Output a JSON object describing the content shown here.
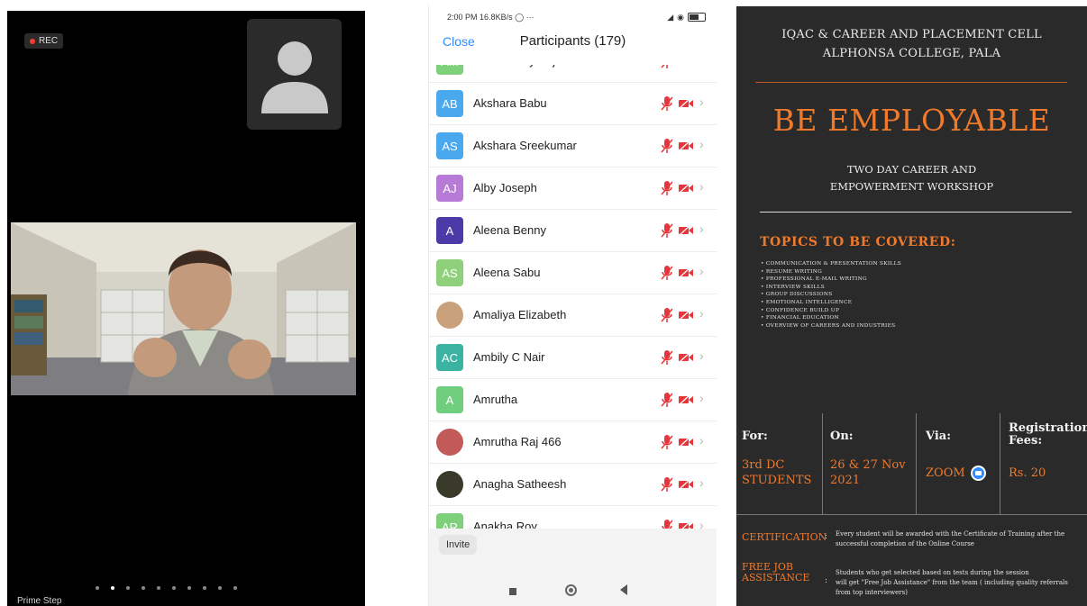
{
  "video": {
    "rec_label": "REC",
    "participant_name": "Prime Step",
    "page_dots": 10,
    "active_dot": 1
  },
  "phone": {
    "status_time": "2:00 PM",
    "status_speed": "16.8KB/s",
    "status_more": "◯ ···",
    "close_label": "Close",
    "title": "Participants (179)",
    "invite_label": "Invite",
    "participants": [
      {
        "initials": "AM",
        "name": "Aileen Mary Saju",
        "color": "#7ed07a",
        "photo": false
      },
      {
        "initials": "AB",
        "name": "Akshara Babu",
        "color": "#4aa8ee",
        "photo": false
      },
      {
        "initials": "AS",
        "name": "Akshara Sreekumar",
        "color": "#4aa8ee",
        "photo": false
      },
      {
        "initials": "AJ",
        "name": "Alby Joseph",
        "color": "#b77ad6",
        "photo": false
      },
      {
        "initials": "A",
        "name": "Aleena Benny",
        "color": "#4b3aa8",
        "photo": false
      },
      {
        "initials": "AS",
        "name": "Aleena Sabu",
        "color": "#8fd17a",
        "photo": false
      },
      {
        "initials": "",
        "name": "Amaliya Elizabeth",
        "color": "#c9a27b",
        "photo": true
      },
      {
        "initials": "AC",
        "name": "Ambily C Nair",
        "color": "#3bb3a3",
        "photo": false
      },
      {
        "initials": "A",
        "name": "Amrutha",
        "color": "#6fcf7e",
        "photo": false
      },
      {
        "initials": "",
        "name": "Amrutha Raj 466",
        "color": "#c25a5a",
        "photo": true
      },
      {
        "initials": "",
        "name": "Anagha Satheesh",
        "color": "#3a3a2a",
        "photo": true
      },
      {
        "initials": "AR",
        "name": "Anakha Roy",
        "color": "#7ed07a",
        "photo": false
      }
    ],
    "colors": {
      "accent": "#2d8cff",
      "muted": "#e5363b"
    }
  },
  "poster": {
    "org_line1": "IQAC & CAREER AND PLACEMENT CELL",
    "org_line2": "ALPHONSA COLLEGE, PALA",
    "headline": "BE EMPLOYABLE",
    "sub_line1": "TWO DAY CAREER AND",
    "sub_line2": "EMPOWERMENT WORKSHOP",
    "topics_title": "TOPICS TO BE COVERED:",
    "topics": [
      "• COMMUNICATION & PRESENTATION SKILLS",
      "• RESUME WRITING",
      "• PROFESSIONAL E-MAIL WRITING",
      "• INTERVIEW SKILLS",
      "• GROUP DISCUSSIONS",
      "• EMOTIONAL INTELLIGENCE",
      "• CONFIDENCE BUILD UP",
      "• FINANCIAL EDUCATION",
      "• OVERVIEW OF CAREERS AND INDUSTRIES"
    ],
    "for_label": "For:",
    "for_value_1": "3rd DC",
    "for_value_2": "STUDENTS",
    "on_label": "On:",
    "on_value_1": "26 & 27 Nov",
    "on_value_2": "2021",
    "via_label": "Via:",
    "via_value": "ZOOM",
    "fees_label_1": "Registration",
    "fees_label_2": "Fees:",
    "fees_value": "Rs. 20",
    "cert_label": "CERTIFICATION",
    "cert_text_1": "Every student will be awarded with the Certificate of Training after the",
    "cert_text_2": "successful completion of the Online Course",
    "job_label_1": "FREE JOB",
    "job_label_2": "ASSISTANCE",
    "job_text_1": "Students who get selected based on tests during the session",
    "job_text_2": "will get \"Free Job Assistance\" from the team ( including quality referrals",
    "job_text_3": "from top interviewers)",
    "colors": {
      "background": "#2a2a2b",
      "accent": "#f07a2c"
    }
  }
}
